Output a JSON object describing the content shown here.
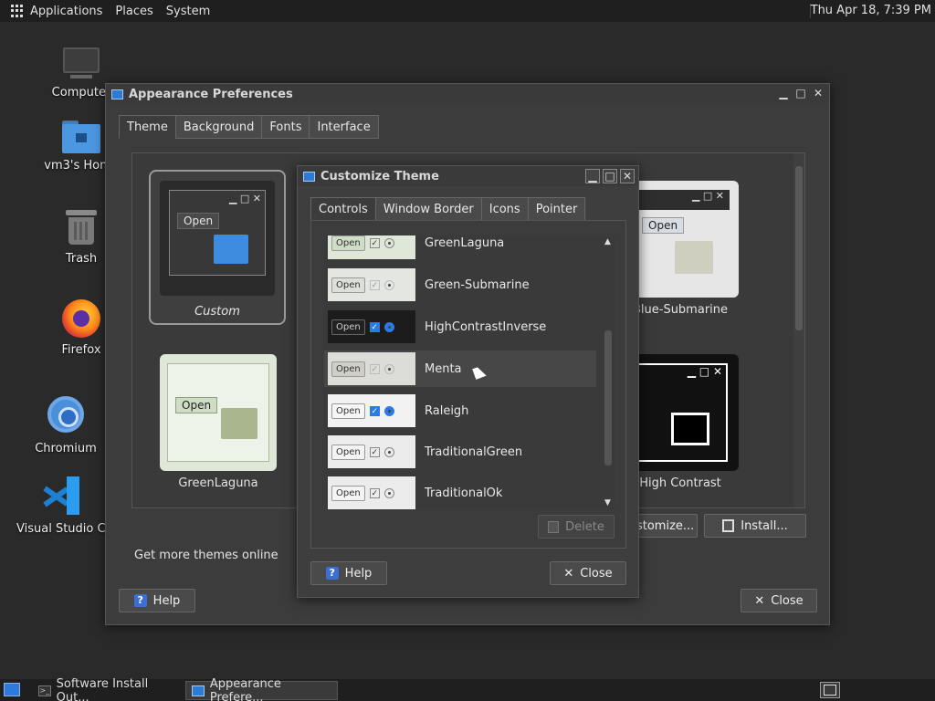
{
  "top_panel": {
    "menus": [
      "Applications",
      "Places",
      "System"
    ],
    "clock": "Thu Apr 18,  7:39 PM"
  },
  "desktop_icons": [
    {
      "label": "Computer",
      "icon": "computer-icon"
    },
    {
      "label": "vm3's Home",
      "icon": "home-folder-icon"
    },
    {
      "label": "Trash",
      "icon": "trash-icon"
    },
    {
      "label": "Firefox",
      "icon": "firefox-icon"
    },
    {
      "label": "Chromium",
      "icon": "chromium-icon"
    },
    {
      "label": "Visual Studio Code",
      "icon": "vscode-icon"
    }
  ],
  "appearance_window": {
    "title": "Appearance Preferences",
    "tabs": [
      "Theme",
      "Background",
      "Fonts",
      "Interface"
    ],
    "active_tab": "Theme",
    "themes": {
      "custom": "Custom",
      "green_laguna": "GreenLaguna",
      "blue_submarine": "Blue-Submarine",
      "high_contrast": "High Contrast"
    },
    "get_more_link": "Get more themes online",
    "customize_button": "Customize...",
    "install_button": "Install...",
    "help_button": "Help",
    "close_button": "Close"
  },
  "customize_window": {
    "title": "Customize Theme",
    "tabs": [
      "Controls",
      "Window Border",
      "Icons",
      "Pointer"
    ],
    "active_tab": "Controls",
    "open_label": "Open",
    "themes_list": [
      {
        "name": "GreenLaguna"
      },
      {
        "name": "Green-Submarine"
      },
      {
        "name": "HighContrastInverse"
      },
      {
        "name": "Menta"
      },
      {
        "name": "Raleigh"
      },
      {
        "name": "TraditionalGreen"
      },
      {
        "name": "TraditionalOk"
      }
    ],
    "delete_button": "Delete",
    "help_button": "Help",
    "close_button": "Close"
  },
  "taskbar": {
    "tasks": [
      {
        "label": "Software Install Out...",
        "active": false
      },
      {
        "label": "Appearance Prefere...",
        "active": true
      }
    ]
  }
}
